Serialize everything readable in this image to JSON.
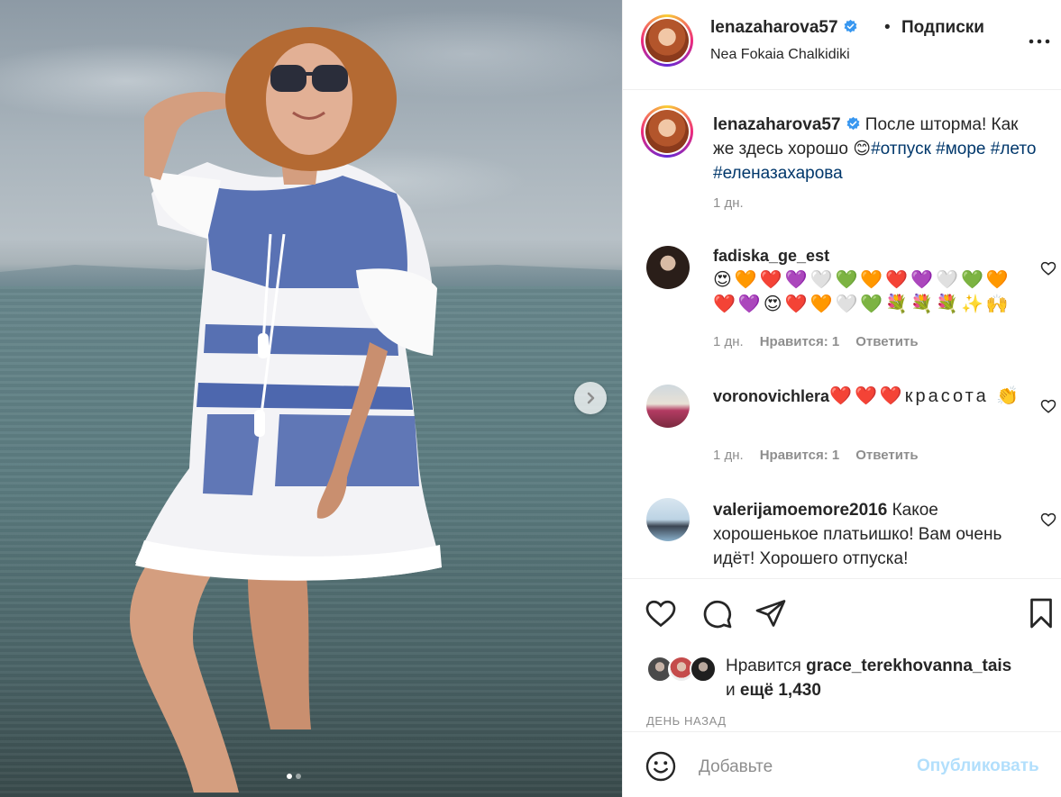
{
  "post": {
    "username": "lenazaharova57",
    "separator": "•",
    "follow_label": "Подписки",
    "location": "Nea Fokaia Chalkidiki",
    "caption_text_a": " После шторма! Как же здесь хорошо 😊",
    "caption_tags": "#отпуск #море #лето #еленазахарова",
    "caption_time": "1 дн."
  },
  "comments": [
    {
      "username": "fadiska_ge_est",
      "text": " 😍🧡❤️💜🤍💚🧡❤️💜🤍💚🧡❤️💜😍❤️🧡🤍💚💐💐💐✨🙌",
      "time": "1 дн.",
      "likes": "Нравится: 1",
      "reply": "Ответить"
    },
    {
      "username": "voronovichlera",
      "text": " ❤️❤️❤️красота 👏",
      "time": "1 дн.",
      "likes": "Нравится: 1",
      "reply": "Ответить"
    },
    {
      "username": "valerijamoemore2016",
      "text": " Какое хорошенькое платьишко! Вам очень идёт! Хорошего отпуска!"
    }
  ],
  "likes": {
    "prefix": "Нравится ",
    "user": "grace_terekhovanna_tais",
    "and": "и ",
    "others": "ещё 1,430"
  },
  "post_date": "ДЕНЬ НАЗАД",
  "comment_box": {
    "placeholder": "Добавьте",
    "publish_label": "Опубликовать"
  },
  "colors": {
    "link": "#00376b",
    "muted": "#8e8e8e",
    "publish_disabled": "#b2dffc",
    "verified": "#3897f0"
  }
}
